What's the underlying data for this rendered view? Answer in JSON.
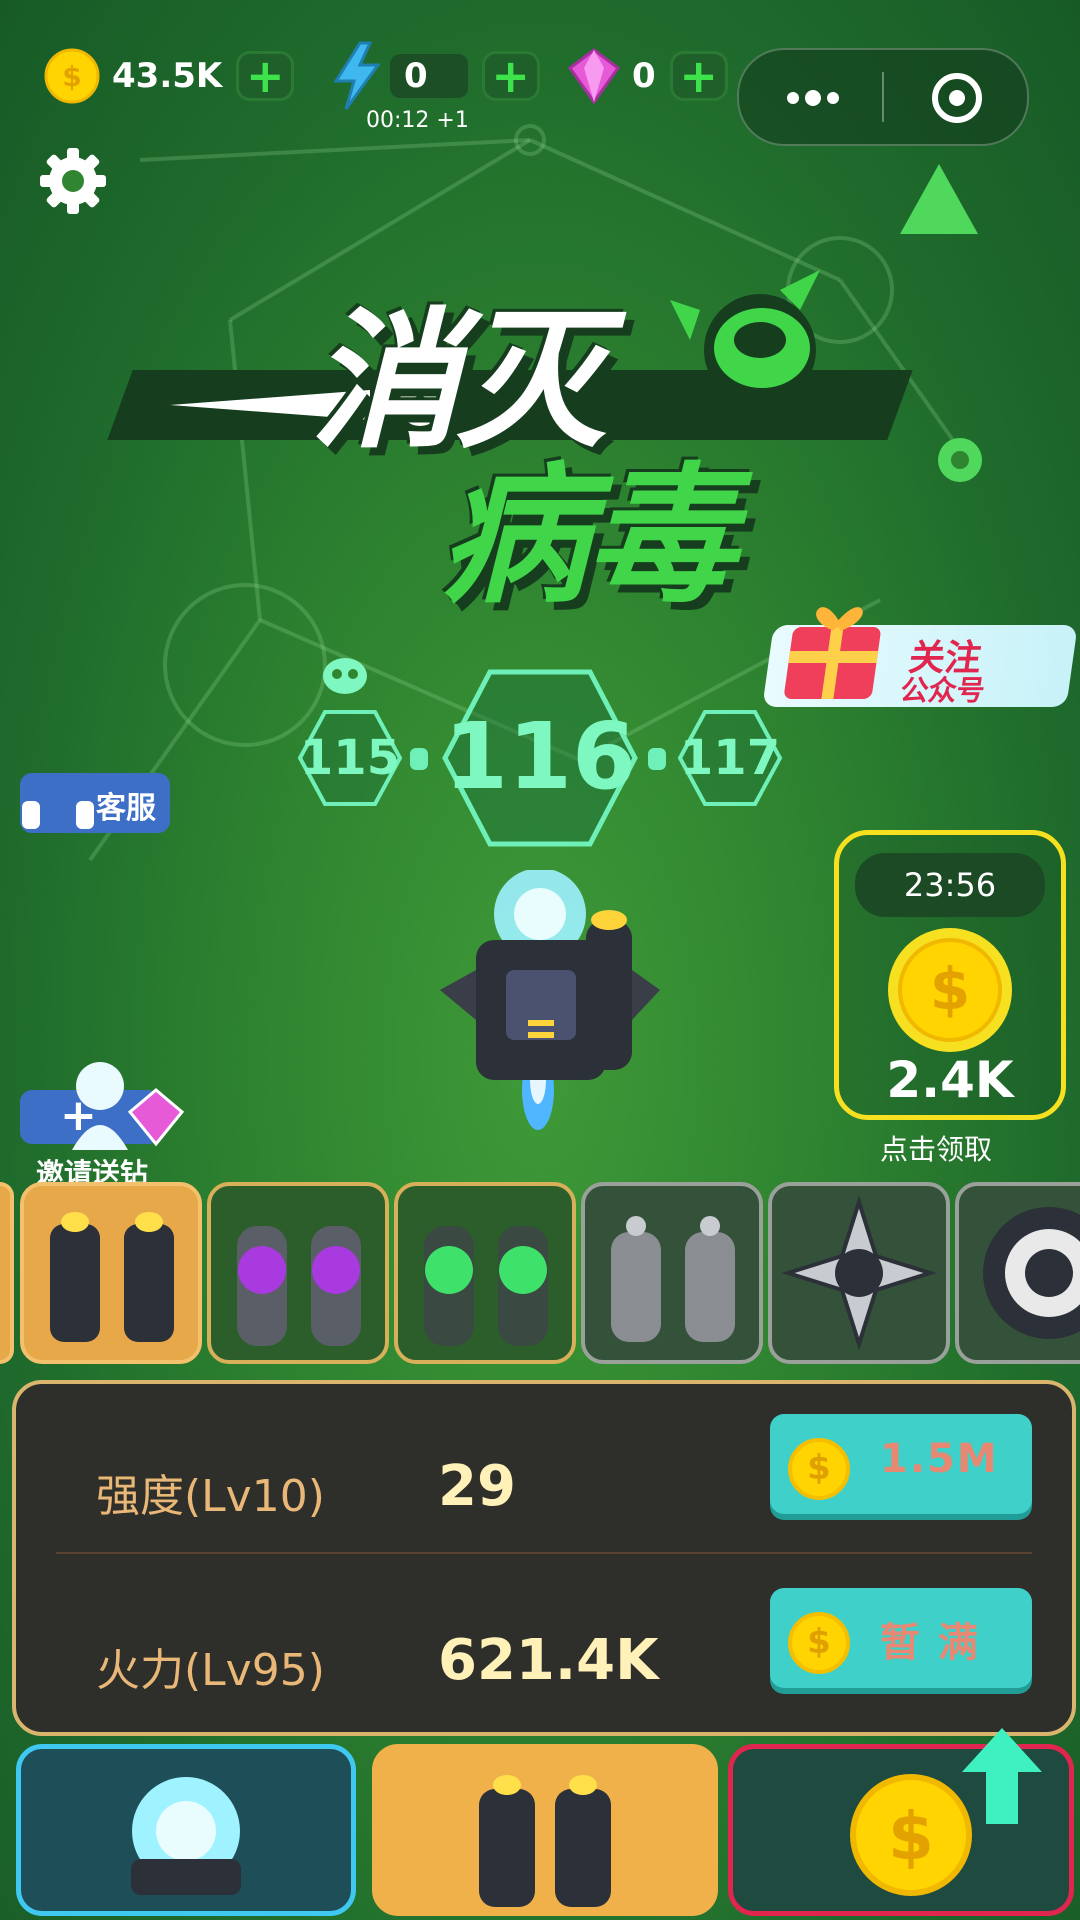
{
  "top_bar": {
    "coins": "43.5K",
    "energy": "0",
    "energy_timer": "00:12 +1",
    "gems": "0"
  },
  "title": {
    "line1": "消灭",
    "line2": "病毒"
  },
  "follow_banner": {
    "line1": "关注",
    "line2": "公众号"
  },
  "levels": {
    "prev": "115",
    "current": "116",
    "next": "117"
  },
  "customer_service": "客服",
  "reward": {
    "timer": "23:56",
    "amount": "2.4K",
    "claim_label": "点击领取"
  },
  "invite_label": "邀请送钻",
  "stats": {
    "strength_label": "强度(Lv10)",
    "strength_value": "29",
    "strength_cost": "1.5M",
    "firepower_label": "火力(Lv95)",
    "firepower_value": "621.4K",
    "firepower_cost": "暂 满"
  },
  "colors": {
    "background": "#2f8530",
    "accent_teal": "#3fd0c9",
    "gold": "#f7e020"
  }
}
